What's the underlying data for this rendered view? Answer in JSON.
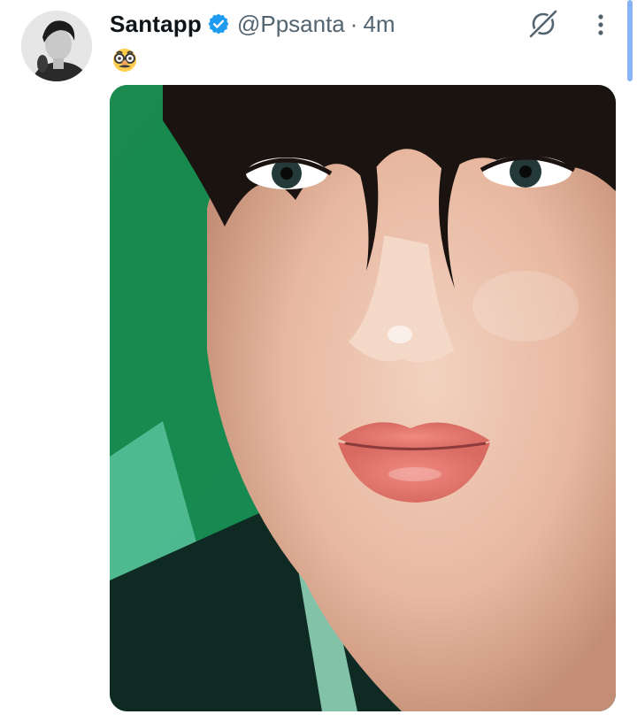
{
  "tweet": {
    "author": {
      "display_name": "Santapp",
      "handle": "@Ppsanta",
      "verified": true,
      "avatar_icon": "profile-photo"
    },
    "separator": "·",
    "timestamp": "4m",
    "text_emoji": "disguised-face-emoji",
    "actions": {
      "grok_icon": "grok-icon",
      "more_icon": "more-vertical-icon"
    },
    "media": {
      "type": "photo",
      "description_icon": "photo"
    }
  },
  "colors": {
    "text_primary": "#0f1419",
    "text_secondary": "#536471",
    "verified_blue": "#1d9bf0",
    "media_background": "#1e7a48",
    "scrollbar": "#8ab4f8"
  }
}
